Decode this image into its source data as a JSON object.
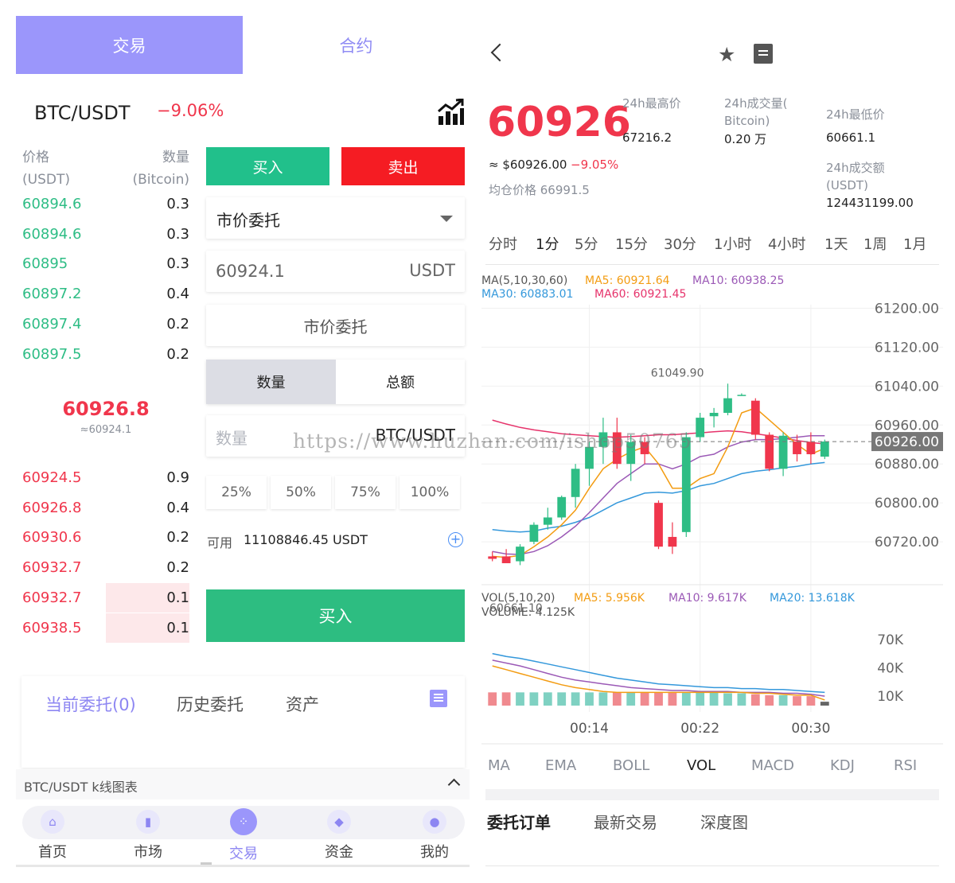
{
  "top_tabs": {
    "trade": "交易",
    "contract": "合约"
  },
  "pair": {
    "name": "BTC/USDT",
    "change": "−9.06%"
  },
  "orderbook": {
    "price_header": "价格",
    "price_unit": "(USDT)",
    "qty_header": "数量",
    "qty_unit": "(Bitcoin)",
    "bids": [
      {
        "price": "60894.6",
        "qty": "0.3"
      },
      {
        "price": "60894.6",
        "qty": "0.3"
      },
      {
        "price": "60895",
        "qty": "0.3"
      },
      {
        "price": "60897.2",
        "qty": "0.4"
      },
      {
        "price": "60897.4",
        "qty": "0.2"
      },
      {
        "price": "60897.5",
        "qty": "0.2"
      }
    ],
    "mid_price": "60926.8",
    "mid_sub": "≈60924.1",
    "asks": [
      {
        "price": "60924.5",
        "qty": "0.9",
        "depth": 0
      },
      {
        "price": "60926.8",
        "qty": "0.4",
        "depth": 0
      },
      {
        "price": "60930.6",
        "qty": "0.2",
        "depth": 0
      },
      {
        "price": "60932.7",
        "qty": "0.2",
        "depth": 0
      },
      {
        "price": "60932.7",
        "qty": "0.1",
        "depth": 0.5
      },
      {
        "price": "60938.5",
        "qty": "0.1",
        "depth": 0.5
      }
    ]
  },
  "order_form": {
    "buy_tab": "买入",
    "sell_tab": "卖出",
    "order_type": "市价委托",
    "price_value": "60924.1",
    "price_unit": "USDT",
    "market_order": "市价委托",
    "qty_tab": "数量",
    "total_tab": "总额",
    "amount_placeholder": "数量",
    "amount_unit": "BTC/USDT",
    "percents": [
      "25%",
      "50%",
      "75%",
      "100%"
    ],
    "available_label": "可用",
    "available_value": "11108846.45 USDT",
    "buy_button": "买入"
  },
  "orders_panel": {
    "current": "当前委托(0)",
    "history": "历史委托",
    "assets": "资产"
  },
  "kline_strip": "BTC/USDT k线图表",
  "bottom_nav": [
    {
      "label": "首页",
      "icon": "home-icon"
    },
    {
      "label": "市场",
      "icon": "market-icon"
    },
    {
      "label": "交易",
      "icon": "trade-icon"
    },
    {
      "label": "资金",
      "icon": "wallet-icon"
    },
    {
      "label": "我的",
      "icon": "user-icon"
    }
  ],
  "detail": {
    "price": "60926",
    "usd": "≈ $60926.00",
    "usd_change": "−9.05%",
    "avg": "均仓价格 66991.5",
    "high_label": "24h最高价",
    "high_value": "67216.2",
    "vol_label_1": "24h成交量(",
    "vol_label_2": "Bitcoin)",
    "vol_value": "0.20 万",
    "low_label": "24h最低价",
    "low_value": "60661.1",
    "turnover_label_1": "24h成交额",
    "turnover_label_2": "(USDT)",
    "turnover_value": "124431199.00"
  },
  "intervals": [
    "分时",
    "1分",
    "5分",
    "15分",
    "30分",
    "1小时",
    "4小时",
    "1天",
    "1周",
    "1月"
  ],
  "active_interval": "1分",
  "indicators": [
    "MA",
    "EMA",
    "BOLL",
    "VOL",
    "MACD",
    "KDJ",
    "RSI"
  ],
  "active_indicator": "VOL",
  "bottom_tabs": [
    "委托订单",
    "最新交易",
    "深度图"
  ],
  "watermark": "https://www.huzhan.com/ishop50765",
  "colors": {
    "up": "#2ebd85",
    "down": "#f0364c",
    "accent": "#9b96fb"
  },
  "chart_data": {
    "type": "candlestick",
    "ma_legend": {
      "title": "MA(5,10,30,60)",
      "ma5": "MA5: 60921.64",
      "ma10": "MA10: 60938.25",
      "ma30": "MA30: 60883.01",
      "ma60": "MA60: 60921.45"
    },
    "y_ticks": [
      "61200.00",
      "61120.00",
      "61040.00",
      "60960.00",
      "60880.00",
      "60800.00",
      "60720.00"
    ],
    "y_ticks_values": [
      61200,
      61120,
      61040,
      60960,
      60880,
      60800,
      60720
    ],
    "ylim": [
      60640,
      61240
    ],
    "last_price_label": "60926.00",
    "last_price": 60926,
    "max_label": "61049.90",
    "max_value": 61049.9,
    "min_label": "60661.10",
    "min_value": 60661.1,
    "candles": [
      {
        "o": 60690,
        "h": 60700,
        "l": 60680,
        "c": 60685
      },
      {
        "o": 60690,
        "h": 60705,
        "l": 60680,
        "c": 60676
      },
      {
        "o": 60680,
        "h": 60715,
        "l": 60672,
        "c": 60710
      },
      {
        "o": 60720,
        "h": 60760,
        "l": 60715,
        "c": 60755
      },
      {
        "o": 60755,
        "h": 60790,
        "l": 60745,
        "c": 60770
      },
      {
        "o": 60770,
        "h": 60815,
        "l": 60765,
        "c": 60812
      },
      {
        "o": 60812,
        "h": 60880,
        "l": 60790,
        "c": 60870
      },
      {
        "o": 60870,
        "h": 60925,
        "l": 60835,
        "c": 60915
      },
      {
        "o": 60915,
        "h": 60975,
        "l": 60880,
        "c": 60945
      },
      {
        "o": 60945,
        "h": 60975,
        "l": 60870,
        "c": 60880
      },
      {
        "o": 60880,
        "h": 60940,
        "l": 60845,
        "c": 60925
      },
      {
        "o": 60925,
        "h": 60935,
        "l": 60880,
        "c": 60900
      },
      {
        "o": 60800,
        "h": 60805,
        "l": 60705,
        "c": 60710
      },
      {
        "o": 60730,
        "h": 60760,
        "l": 60695,
        "c": 60710
      },
      {
        "o": 60740,
        "h": 60945,
        "l": 60730,
        "c": 60935
      },
      {
        "o": 60935,
        "h": 60985,
        "l": 60925,
        "c": 60975
      },
      {
        "o": 60978,
        "h": 60995,
        "l": 60955,
        "c": 60985
      },
      {
        "o": 60985,
        "h": 61045,
        "l": 60980,
        "c": 61015
      },
      {
        "o": 61022,
        "h": 61025,
        "l": 61020,
        "c": 61022
      },
      {
        "o": 61010,
        "h": 61015,
        "l": 60930,
        "c": 60940
      },
      {
        "o": 60940,
        "h": 60945,
        "l": 60865,
        "c": 60870
      },
      {
        "o": 60870,
        "h": 60945,
        "l": 60855,
        "c": 60938
      },
      {
        "o": 60926,
        "h": 60940,
        "l": 60885,
        "c": 60900
      },
      {
        "o": 60925,
        "h": 60945,
        "l": 60880,
        "c": 60900
      },
      {
        "o": 60895,
        "h": 60930,
        "l": 60890,
        "c": 60926
      }
    ],
    "ma5": [
      60690,
      60688,
      60692,
      60710,
      60730,
      60755,
      60785,
      60830,
      60870,
      60890,
      60905,
      60915,
      60880,
      60830,
      60830,
      60850,
      60860,
      60915,
      60985,
      60995,
      60970,
      60945,
      60920,
      60900,
      60912
    ],
    "ma10": [
      60700,
      60695,
      60694,
      60700,
      60712,
      60730,
      60752,
      60780,
      60810,
      60840,
      60860,
      60880,
      60880,
      60870,
      60880,
      60895,
      60900,
      60915,
      60925,
      60930,
      60930,
      60932,
      60935,
      60938,
      60938
    ],
    "ma30": [
      60745,
      60742,
      60740,
      60742,
      60748,
      60752,
      60760,
      60770,
      60785,
      60800,
      60810,
      60820,
      60822,
      60820,
      60825,
      60835,
      60840,
      60850,
      60860,
      60865,
      60868,
      60872,
      60875,
      60880,
      60883
    ],
    "ma60": [
      60970,
      60962,
      60955,
      60950,
      60946,
      60942,
      60940,
      60938,
      60936,
      60935,
      60936,
      60938,
      60940,
      60940,
      60942,
      60944,
      60946,
      60948,
      60946,
      60942,
      60938,
      60933,
      60928,
      60924,
      60921
    ],
    "vol_legend": {
      "title": "VOL(5,10,20)",
      "ma5": "MA5: 5.956K",
      "ma10": "MA10: 9.617K",
      "ma20": "MA20: 13.618K",
      "volume": "VOLUME: 4.125K"
    },
    "vol_ticks": [
      "70K",
      "40K",
      "10K"
    ],
    "vol_ticks_values": [
      70,
      40,
      10
    ],
    "vol_ylim": [
      0,
      90
    ],
    "volumes": [
      14,
      14,
      14,
      14,
      14,
      14,
      14,
      14,
      14,
      14,
      14,
      14,
      14,
      14,
      14,
      14,
      14,
      13,
      13,
      12,
      11,
      11,
      10,
      10,
      4.1
    ],
    "vol_ma5": [
      42,
      38,
      34,
      30,
      26,
      22,
      19,
      17,
      15,
      14,
      14,
      14,
      14,
      14,
      14,
      14,
      14,
      14,
      14,
      13,
      13,
      12,
      11,
      11,
      6
    ],
    "vol_ma10": [
      48,
      45,
      42,
      38,
      34,
      30,
      27,
      25,
      23,
      21,
      19,
      18,
      17,
      16,
      16,
      15,
      15,
      15,
      14,
      14,
      14,
      13,
      13,
      12,
      10
    ],
    "vol_ma20": [
      55,
      52,
      50,
      47,
      44,
      41,
      38,
      35,
      32,
      29,
      27,
      25,
      23,
      22,
      21,
      20,
      19,
      19,
      18,
      18,
      17,
      17,
      16,
      15,
      14
    ],
    "x_ticks": [
      "00:14",
      "00:22",
      "00:30"
    ],
    "x_ticks_index": [
      7,
      15,
      23
    ]
  }
}
